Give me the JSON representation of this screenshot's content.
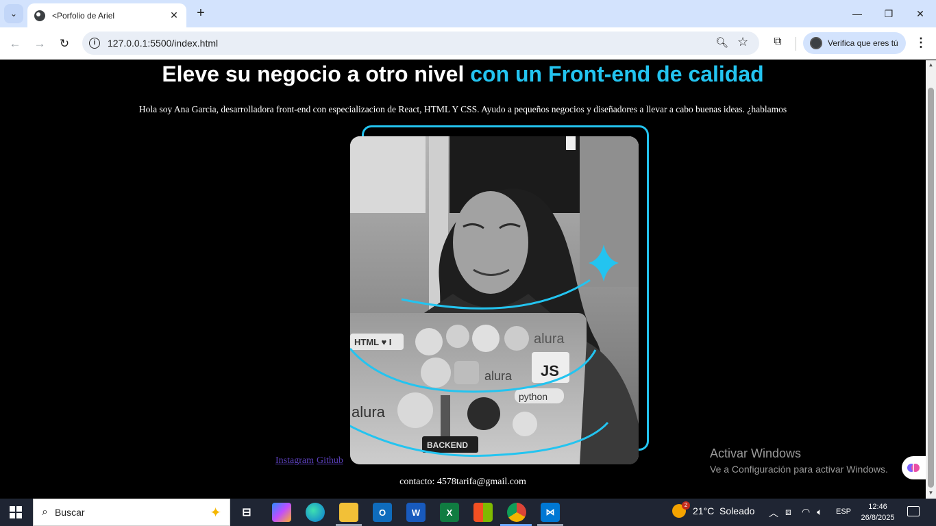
{
  "browser": {
    "tab_title": "<Porfolio de Ariel",
    "url": "127.0.0.1:5500/index.html",
    "profile_label": "Verifica que eres tú"
  },
  "page": {
    "headline_white": "Eleve su negocio a otro nivel",
    "headline_accent": "con un Front-end de calidad",
    "intro": "Hola soy Ana Garcia, desarrolladora front-end con especializacion de React, HTML Y CSS. Ayudo a pequeños negocios y diseñadores a llevar a cabo buenas ideas. ¿hablamos",
    "links": [
      {
        "label": "Instagram"
      },
      {
        "label": "Github"
      }
    ],
    "contact": "contacto: 4578tarifa@gmail.com",
    "accent_color": "#23c4f0",
    "sticker_texts": [
      "HTML ♥ I",
      "alura",
      "JS",
      "alura",
      "python",
      "alura",
      "BACKEND"
    ]
  },
  "watermark": {
    "line1": "Activar Windows",
    "line2": "Ve a Configuración para activar Windows."
  },
  "taskbar": {
    "search_placeholder": "Buscar",
    "weather": "21°C  Soleado",
    "weather_badge": "2",
    "language": "ESP",
    "time": "12:46",
    "date": "26/8/2025",
    "apps": [
      "task-view",
      "copilot",
      "edge",
      "file-explorer",
      "outlook",
      "word",
      "excel",
      "store",
      "chrome",
      "vscode"
    ]
  }
}
